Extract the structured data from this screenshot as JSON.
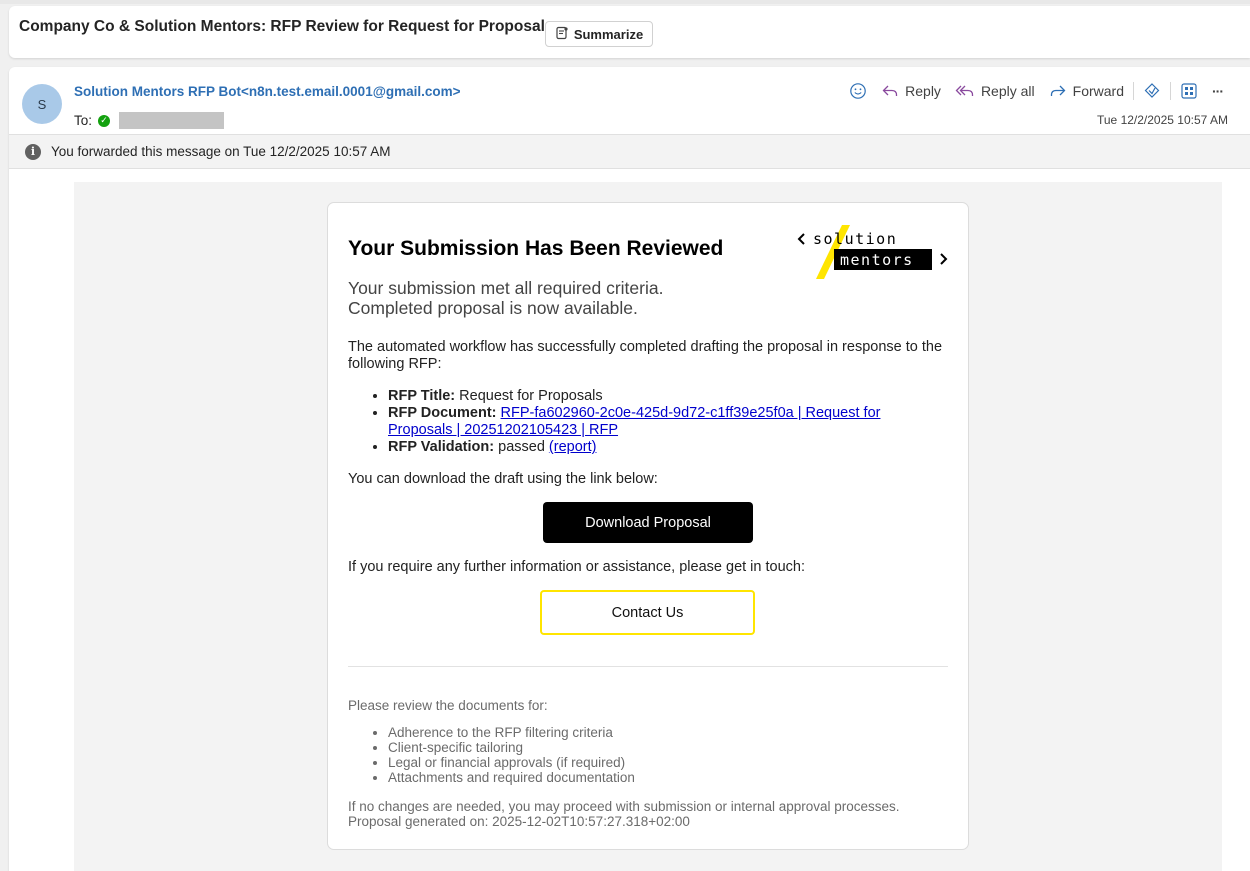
{
  "subject": {
    "title": "Company Co & Solution Mentors: RFP Review for Request for Proposals",
    "summarize_label": "Summarize"
  },
  "message": {
    "avatar_initial": "S",
    "sender_name": "Solution Mentors RFP Bot",
    "sender_email": "<n8n.test.email.0001@gmail.com>",
    "to_label": "To:",
    "date": "Tue 12/2/2025 10:57 AM",
    "actions": {
      "reply": "Reply",
      "reply_all": "Reply all",
      "forward": "Forward",
      "more": "···"
    },
    "info_bar": "You forwarded this message on Tue 12/2/2025 10:57 AM"
  },
  "email": {
    "heading": "Your Submission Has Been Reviewed",
    "subheading_line1": "Your submission met all required criteria.",
    "subheading_line2": "Completed proposal is now available.",
    "intro": "The automated workflow has successfully completed drafting the proposal in response to the following RFP:",
    "rfp_title_label": "RFP Title:",
    "rfp_title_value": "Request for Proposals",
    "rfp_document_label": "RFP Document:",
    "rfp_document_link": "RFP-fa602960-2c0e-425d-9d72-c1ff39e25f0a | Request for Proposals | 20251202105423 | RFP",
    "rfp_validation_label": "RFP Validation:",
    "rfp_validation_value": "passed",
    "rfp_validation_link": "(report)",
    "download_text": "You can download the draft using the link below:",
    "download_button": "Download Proposal",
    "contact_text": "If you require any further information or assistance, please get in touch:",
    "contact_button": "Contact Us",
    "review_intro": "Please review the documents for:",
    "review_items": [
      "Adherence to the RFP filtering criteria",
      "Client-specific tailoring",
      "Legal or financial approvals (if required)",
      "Attachments and required documentation"
    ],
    "closing_line1": "If no changes are needed, you may proceed with submission or internal approval processes.",
    "closing_line2": "Proposal generated on: 2025-12-02T10:57:27.318+02:00",
    "logo_top": "solution",
    "logo_bottom": "mentors"
  },
  "colors": {
    "accent_link": "#2e6fb4",
    "logo_yellow": "#ffe500",
    "button_dark": "#000000"
  }
}
